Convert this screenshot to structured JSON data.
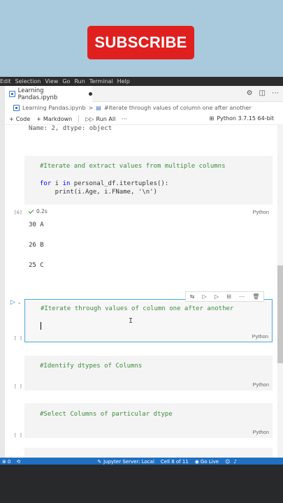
{
  "overlay": {
    "subscribe_label": "SUBSCRIBE"
  },
  "menubar": [
    "Edit",
    "Selection",
    "View",
    "Go",
    "Run",
    "Terminal",
    "Help"
  ],
  "tab": {
    "filename": "Learning Pandas.ipynb"
  },
  "breadcrumb": {
    "file": "Learning Pandas.ipynb",
    "separator": ">",
    "section": "#Iterate through values of column one after another"
  },
  "toolbar": {
    "code_label": "Code",
    "markdown_label": "Markdown",
    "run_all_label": "Run All",
    "more": "···",
    "kernel_label": "Python 3.7.15 64-bit"
  },
  "cells": {
    "truncated_output": "Name: 2, dtype: object",
    "cell1": {
      "line1": "#Iterate and extract values from multiple columns",
      "line3_kw1": "for",
      "line3_var": " i ",
      "line3_kw2": "in",
      "line3_rest": " personal_df.itertuples():",
      "line4": "    print(i.Age, i.FName, '\\n')",
      "exec_count": "[6]",
      "time": "0.2s",
      "lang": "Python"
    },
    "outputs": [
      "30 A",
      "26 B",
      "25 C"
    ],
    "cell2": {
      "line1": "#Iterate through values of column one after another",
      "exec_count": "[ ]",
      "lang": "Python"
    },
    "cell3": {
      "line1": "#Identify dtypes of Columns",
      "exec_count": "[ ]",
      "lang": "Python"
    },
    "cell4": {
      "line1": "#Select Columns of particular dtype",
      "exec_count": "[ ]",
      "lang": "Python"
    }
  },
  "statusbar": {
    "errors": "0",
    "jupyter": "Jupyter Server: Local",
    "cell_position": "Cell 8 of 11",
    "golive": "Go Live"
  },
  "colors": {
    "status_blue": "#1f6fc4",
    "subscribe_red": "#e0201f",
    "comment_green": "#3c8d3c",
    "keyword_blue": "#0000ff"
  }
}
